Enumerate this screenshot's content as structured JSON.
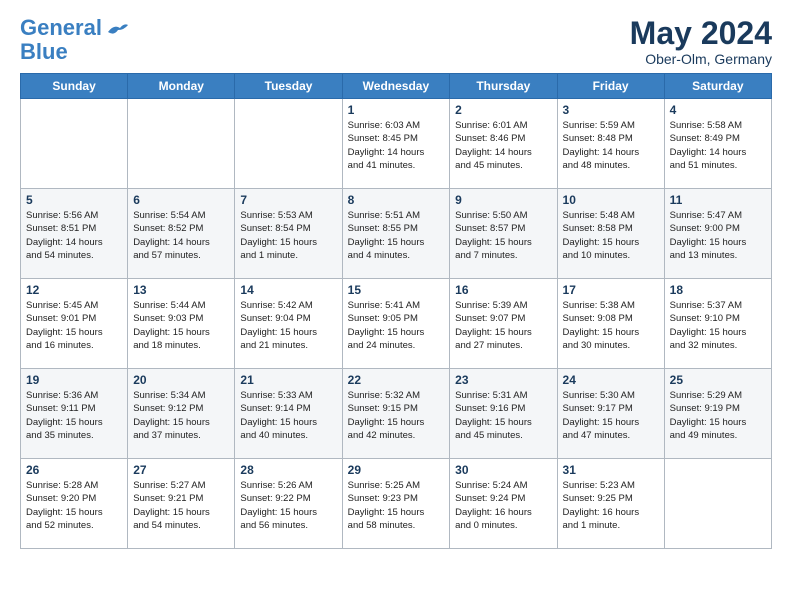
{
  "header": {
    "logo_line1": "General",
    "logo_line2": "Blue",
    "month_year": "May 2024",
    "location": "Ober-Olm, Germany"
  },
  "weekdays": [
    "Sunday",
    "Monday",
    "Tuesday",
    "Wednesday",
    "Thursday",
    "Friday",
    "Saturday"
  ],
  "weeks": [
    [
      {
        "day": "",
        "info": ""
      },
      {
        "day": "",
        "info": ""
      },
      {
        "day": "",
        "info": ""
      },
      {
        "day": "1",
        "info": "Sunrise: 6:03 AM\nSunset: 8:45 PM\nDaylight: 14 hours\nand 41 minutes."
      },
      {
        "day": "2",
        "info": "Sunrise: 6:01 AM\nSunset: 8:46 PM\nDaylight: 14 hours\nand 45 minutes."
      },
      {
        "day": "3",
        "info": "Sunrise: 5:59 AM\nSunset: 8:48 PM\nDaylight: 14 hours\nand 48 minutes."
      },
      {
        "day": "4",
        "info": "Sunrise: 5:58 AM\nSunset: 8:49 PM\nDaylight: 14 hours\nand 51 minutes."
      }
    ],
    [
      {
        "day": "5",
        "info": "Sunrise: 5:56 AM\nSunset: 8:51 PM\nDaylight: 14 hours\nand 54 minutes."
      },
      {
        "day": "6",
        "info": "Sunrise: 5:54 AM\nSunset: 8:52 PM\nDaylight: 14 hours\nand 57 minutes."
      },
      {
        "day": "7",
        "info": "Sunrise: 5:53 AM\nSunset: 8:54 PM\nDaylight: 15 hours\nand 1 minute."
      },
      {
        "day": "8",
        "info": "Sunrise: 5:51 AM\nSunset: 8:55 PM\nDaylight: 15 hours\nand 4 minutes."
      },
      {
        "day": "9",
        "info": "Sunrise: 5:50 AM\nSunset: 8:57 PM\nDaylight: 15 hours\nand 7 minutes."
      },
      {
        "day": "10",
        "info": "Sunrise: 5:48 AM\nSunset: 8:58 PM\nDaylight: 15 hours\nand 10 minutes."
      },
      {
        "day": "11",
        "info": "Sunrise: 5:47 AM\nSunset: 9:00 PM\nDaylight: 15 hours\nand 13 minutes."
      }
    ],
    [
      {
        "day": "12",
        "info": "Sunrise: 5:45 AM\nSunset: 9:01 PM\nDaylight: 15 hours\nand 16 minutes."
      },
      {
        "day": "13",
        "info": "Sunrise: 5:44 AM\nSunset: 9:03 PM\nDaylight: 15 hours\nand 18 minutes."
      },
      {
        "day": "14",
        "info": "Sunrise: 5:42 AM\nSunset: 9:04 PM\nDaylight: 15 hours\nand 21 minutes."
      },
      {
        "day": "15",
        "info": "Sunrise: 5:41 AM\nSunset: 9:05 PM\nDaylight: 15 hours\nand 24 minutes."
      },
      {
        "day": "16",
        "info": "Sunrise: 5:39 AM\nSunset: 9:07 PM\nDaylight: 15 hours\nand 27 minutes."
      },
      {
        "day": "17",
        "info": "Sunrise: 5:38 AM\nSunset: 9:08 PM\nDaylight: 15 hours\nand 30 minutes."
      },
      {
        "day": "18",
        "info": "Sunrise: 5:37 AM\nSunset: 9:10 PM\nDaylight: 15 hours\nand 32 minutes."
      }
    ],
    [
      {
        "day": "19",
        "info": "Sunrise: 5:36 AM\nSunset: 9:11 PM\nDaylight: 15 hours\nand 35 minutes."
      },
      {
        "day": "20",
        "info": "Sunrise: 5:34 AM\nSunset: 9:12 PM\nDaylight: 15 hours\nand 37 minutes."
      },
      {
        "day": "21",
        "info": "Sunrise: 5:33 AM\nSunset: 9:14 PM\nDaylight: 15 hours\nand 40 minutes."
      },
      {
        "day": "22",
        "info": "Sunrise: 5:32 AM\nSunset: 9:15 PM\nDaylight: 15 hours\nand 42 minutes."
      },
      {
        "day": "23",
        "info": "Sunrise: 5:31 AM\nSunset: 9:16 PM\nDaylight: 15 hours\nand 45 minutes."
      },
      {
        "day": "24",
        "info": "Sunrise: 5:30 AM\nSunset: 9:17 PM\nDaylight: 15 hours\nand 47 minutes."
      },
      {
        "day": "25",
        "info": "Sunrise: 5:29 AM\nSunset: 9:19 PM\nDaylight: 15 hours\nand 49 minutes."
      }
    ],
    [
      {
        "day": "26",
        "info": "Sunrise: 5:28 AM\nSunset: 9:20 PM\nDaylight: 15 hours\nand 52 minutes."
      },
      {
        "day": "27",
        "info": "Sunrise: 5:27 AM\nSunset: 9:21 PM\nDaylight: 15 hours\nand 54 minutes."
      },
      {
        "day": "28",
        "info": "Sunrise: 5:26 AM\nSunset: 9:22 PM\nDaylight: 15 hours\nand 56 minutes."
      },
      {
        "day": "29",
        "info": "Sunrise: 5:25 AM\nSunset: 9:23 PM\nDaylight: 15 hours\nand 58 minutes."
      },
      {
        "day": "30",
        "info": "Sunrise: 5:24 AM\nSunset: 9:24 PM\nDaylight: 16 hours\nand 0 minutes."
      },
      {
        "day": "31",
        "info": "Sunrise: 5:23 AM\nSunset: 9:25 PM\nDaylight: 16 hours\nand 1 minute."
      },
      {
        "day": "",
        "info": ""
      }
    ]
  ]
}
